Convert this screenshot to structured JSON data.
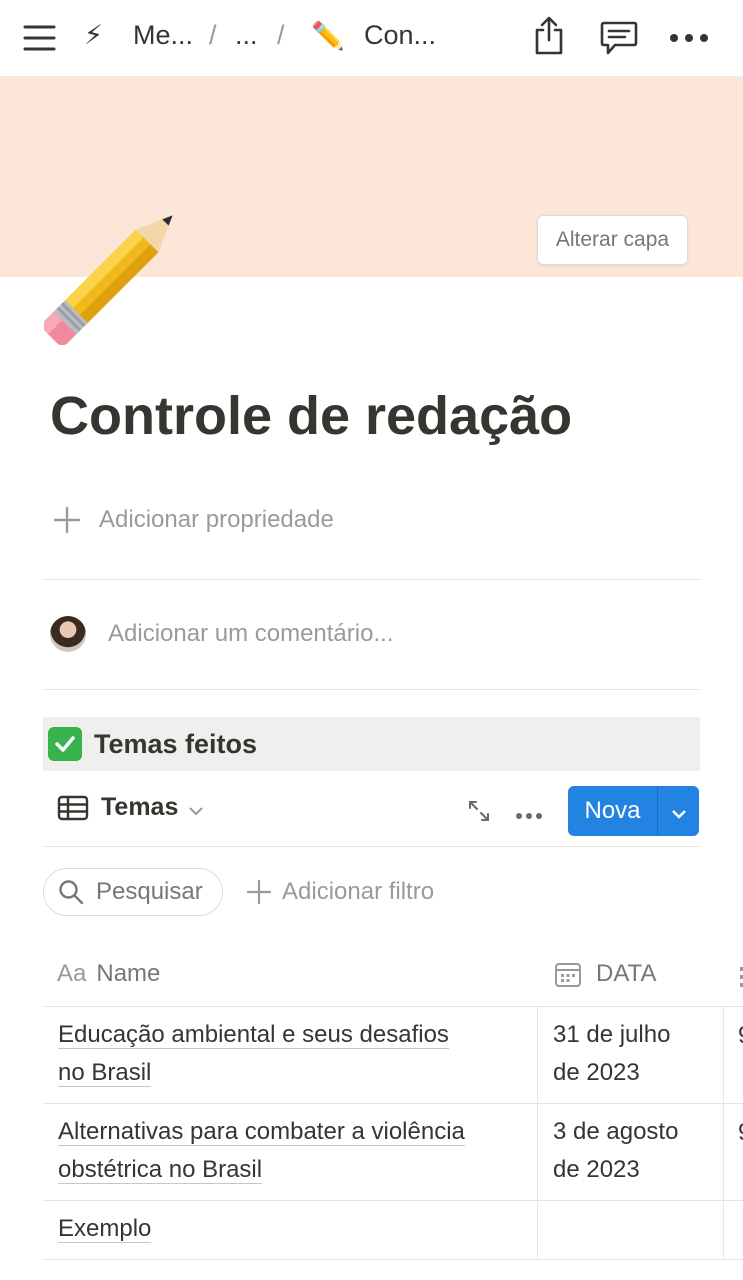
{
  "topbar": {
    "menu_icon": "hamburger-icon",
    "crumb1_icon": "⚡",
    "crumb1_label": "Me...",
    "crumb2_label": "...",
    "crumb3_icon": "✏️",
    "crumb3_label": "Con...",
    "separator": "/",
    "share_icon": "share-icon",
    "comments_icon": "comment-icon",
    "more_icon": "more-horizontal-icon"
  },
  "cover": {
    "color": "#fce6d8",
    "change_label": "Alterar capa"
  },
  "page": {
    "icon": "✏️",
    "title": "Controle de redação",
    "add_property_label": "Adicionar propriedade",
    "comment_placeholder": "Adicionar um comentário..."
  },
  "callout": {
    "icon": "✅",
    "text": "Temas feitos"
  },
  "database": {
    "view_label": "Temas",
    "new_button_label": "Nova",
    "search_label": "Pesquisar",
    "add_filter_label": "Adicionar filtro",
    "columns": [
      {
        "icon": "Aa",
        "label": "Name"
      },
      {
        "icon": "calendar-icon",
        "label": "DATA"
      }
    ],
    "rows": [
      {
        "name": [
          "Educação ambiental e seus desafios",
          "no Brasil"
        ],
        "date": [
          "31 de julho",
          "de 2023"
        ],
        "edge": "9"
      },
      {
        "name": [
          "Alternativas para combater a violência",
          "obstétrica no Brasil"
        ],
        "date": [
          "3 de agosto",
          "de 2023"
        ],
        "edge": "9"
      },
      {
        "name": [
          "Exemplo"
        ],
        "date": [],
        "edge": ""
      }
    ]
  }
}
